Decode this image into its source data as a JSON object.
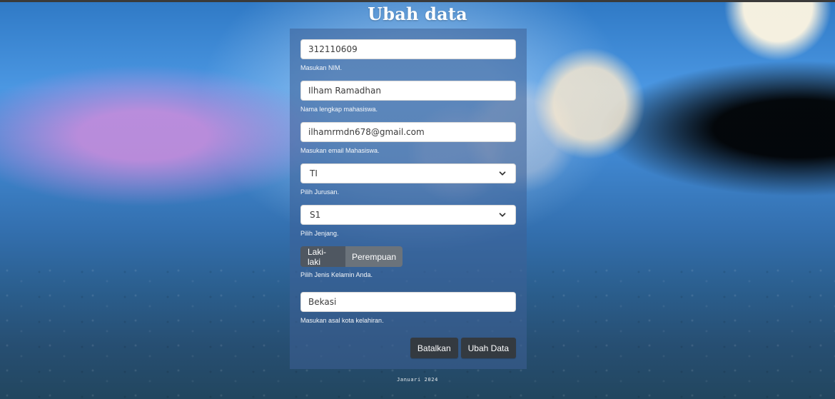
{
  "page": {
    "title": "Ubah data",
    "footer": "Januari 2024"
  },
  "form": {
    "nim": {
      "value": "312110609",
      "help": "Masukan NIM."
    },
    "nama": {
      "value": "Ilham Ramadhan",
      "help": "Nama lengkap mahasiswa."
    },
    "email": {
      "value": "ilhamrmdn678@gmail.com",
      "help": "Masukan email Mahasiswa."
    },
    "jurusan": {
      "selected": "TI",
      "help": "Pilih Jurusan."
    },
    "jenjang": {
      "selected": "S1",
      "help": "Pilih Jenjang."
    },
    "gender": {
      "options": [
        "Laki-laki",
        "Perempuan"
      ],
      "help": "Pilih Jenis Kelamin Anda."
    },
    "kota": {
      "value": "Bekasi",
      "help": "Masukan asal kota kelahiran."
    },
    "actions": {
      "cancel_label": "Batalkan",
      "submit_label": "Ubah Data"
    }
  },
  "icons": {
    "select_chevron": "chevron-down-icon"
  }
}
